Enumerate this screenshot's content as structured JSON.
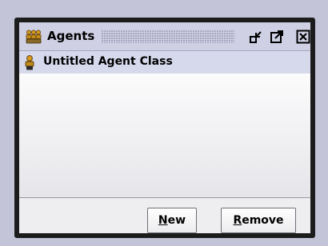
{
  "window": {
    "title": "Agents",
    "title_icon": "agents-group-icon",
    "controls": {
      "iconify_icon": "iconify-icon",
      "maximize_icon": "maximize-icon",
      "close_icon": "close-icon"
    }
  },
  "list": {
    "items": [
      {
        "label": "Untitled Agent Class",
        "icon": "agent-icon",
        "selected": true
      }
    ]
  },
  "buttons": {
    "new": {
      "mnemonic": "N",
      "rest": "ew"
    },
    "remove": {
      "mnemonic": "R",
      "rest": "emove"
    }
  },
  "colors": {
    "desktop": "#c4c4d8",
    "titlebar": "#cfd0e4",
    "selection": "#d6d8ec",
    "icon_gold": "#c08a1c"
  }
}
